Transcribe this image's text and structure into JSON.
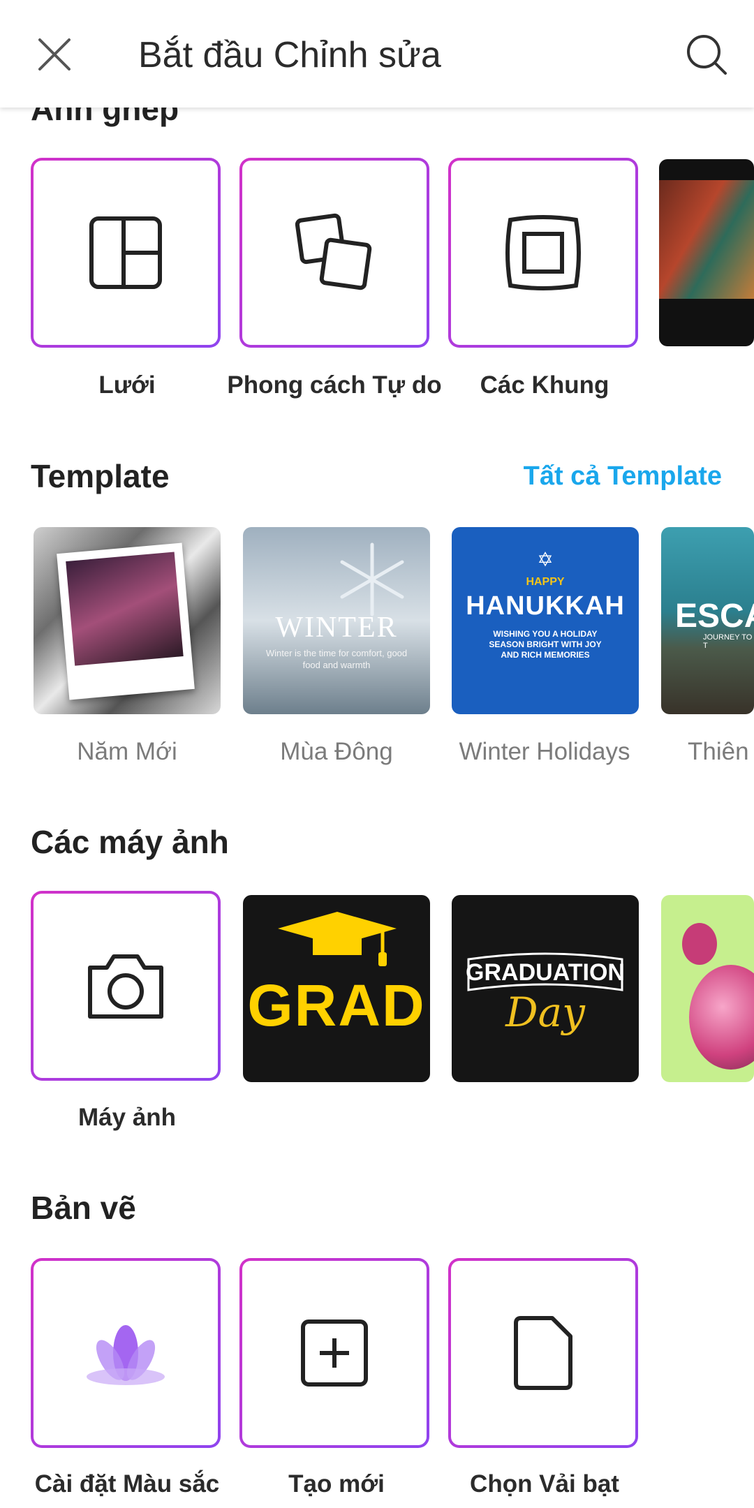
{
  "header": {
    "title": "Bắt đầu Chỉnh sửa",
    "close_icon": "close-icon",
    "search_icon": "search-icon"
  },
  "collage": {
    "title": "Ảnh ghép",
    "items": [
      {
        "label": "Lưới",
        "icon": "grid-layout-icon"
      },
      {
        "label": "Phong cách Tự do",
        "icon": "freestyle-icon"
      },
      {
        "label": "Các Khung",
        "icon": "frame-icon"
      }
    ]
  },
  "templates": {
    "title": "Template",
    "see_all": "Tất cả Template",
    "items": [
      {
        "label": "Năm Mới"
      },
      {
        "label": "Mùa Đông",
        "text_title": "WINTER",
        "text_sub": "Winter is the time for comfort, good food and warmth"
      },
      {
        "label": "Winter Holidays",
        "text_happy": "HAPPY",
        "text_title": "HANUKKAH",
        "text_sub": "WISHING YOU A HOLIDAY SEASON BRIGHT WITH JOY AND RICH MEMORIES"
      },
      {
        "label": "Thiên",
        "text_title": "ESCA",
        "text_sub": "JOURNEY TO T"
      }
    ]
  },
  "cameras": {
    "title": "Các máy ảnh",
    "items": [
      {
        "label": "Máy ảnh",
        "icon": "camera-icon"
      },
      {
        "label": "",
        "text": "GRAD"
      },
      {
        "label": "",
        "text_title": "GRADUATION",
        "text_sub": "Day"
      },
      {
        "label": ""
      }
    ]
  },
  "drawing": {
    "title": "Bản vẽ",
    "items": [
      {
        "label": "Cài đặt Màu sắc",
        "icon": "lotus-icon"
      },
      {
        "label": "Tạo mới",
        "icon": "add-square-icon"
      },
      {
        "label": "Chọn Vải bạt",
        "icon": "document-icon"
      }
    ]
  },
  "colors": {
    "accent_blue": "#1aa7ec",
    "border_pink": "#d231c8",
    "border_purple": "#8e44ef",
    "grad_yellow": "#ffd100"
  }
}
